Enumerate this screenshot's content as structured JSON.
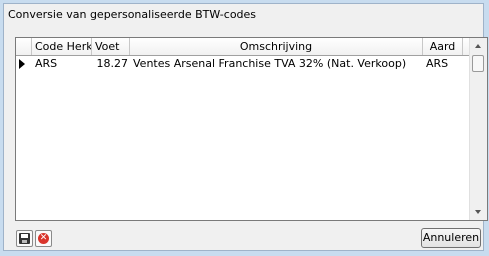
{
  "window": {
    "title": "Conversie van gepersonaliseerde BTW-codes"
  },
  "grid": {
    "columns": [
      "Code Herk.",
      "Voet",
      "Omschrijving",
      "Aard"
    ],
    "rows": [
      {
        "code": "ARS",
        "voet": "18.27",
        "omschrijving": "Ventes Arsenal Franchise TVA 32% (Nat. Verkoop)",
        "aard": "ARS"
      }
    ]
  },
  "toolbar": {
    "save_icon": "save-icon",
    "cancel_icon": "cancel-icon",
    "cancel_glyph": "✕",
    "annuleren_label": "Annuleren"
  },
  "icons": {
    "row_indicator": "row-indicator-icon",
    "scroll_up": "scroll-up-icon",
    "scroll_down": "scroll-down-icon"
  }
}
